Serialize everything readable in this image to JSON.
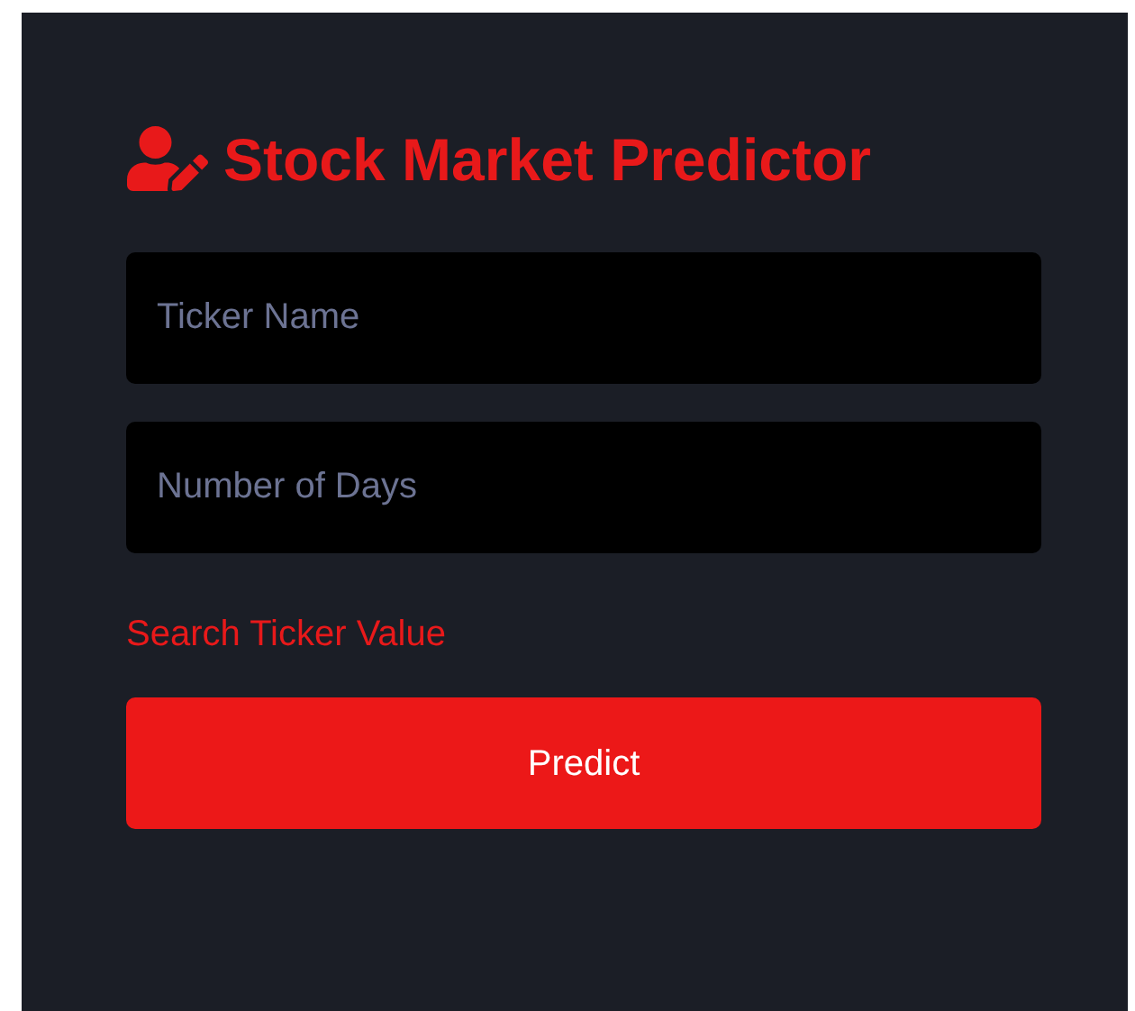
{
  "title": "Stock Market Predictor",
  "fields": [
    {
      "placeholder": "Ticker Name"
    },
    {
      "placeholder": "Number of Days"
    }
  ],
  "link": "Search Ticker Value",
  "button": "Predict"
}
